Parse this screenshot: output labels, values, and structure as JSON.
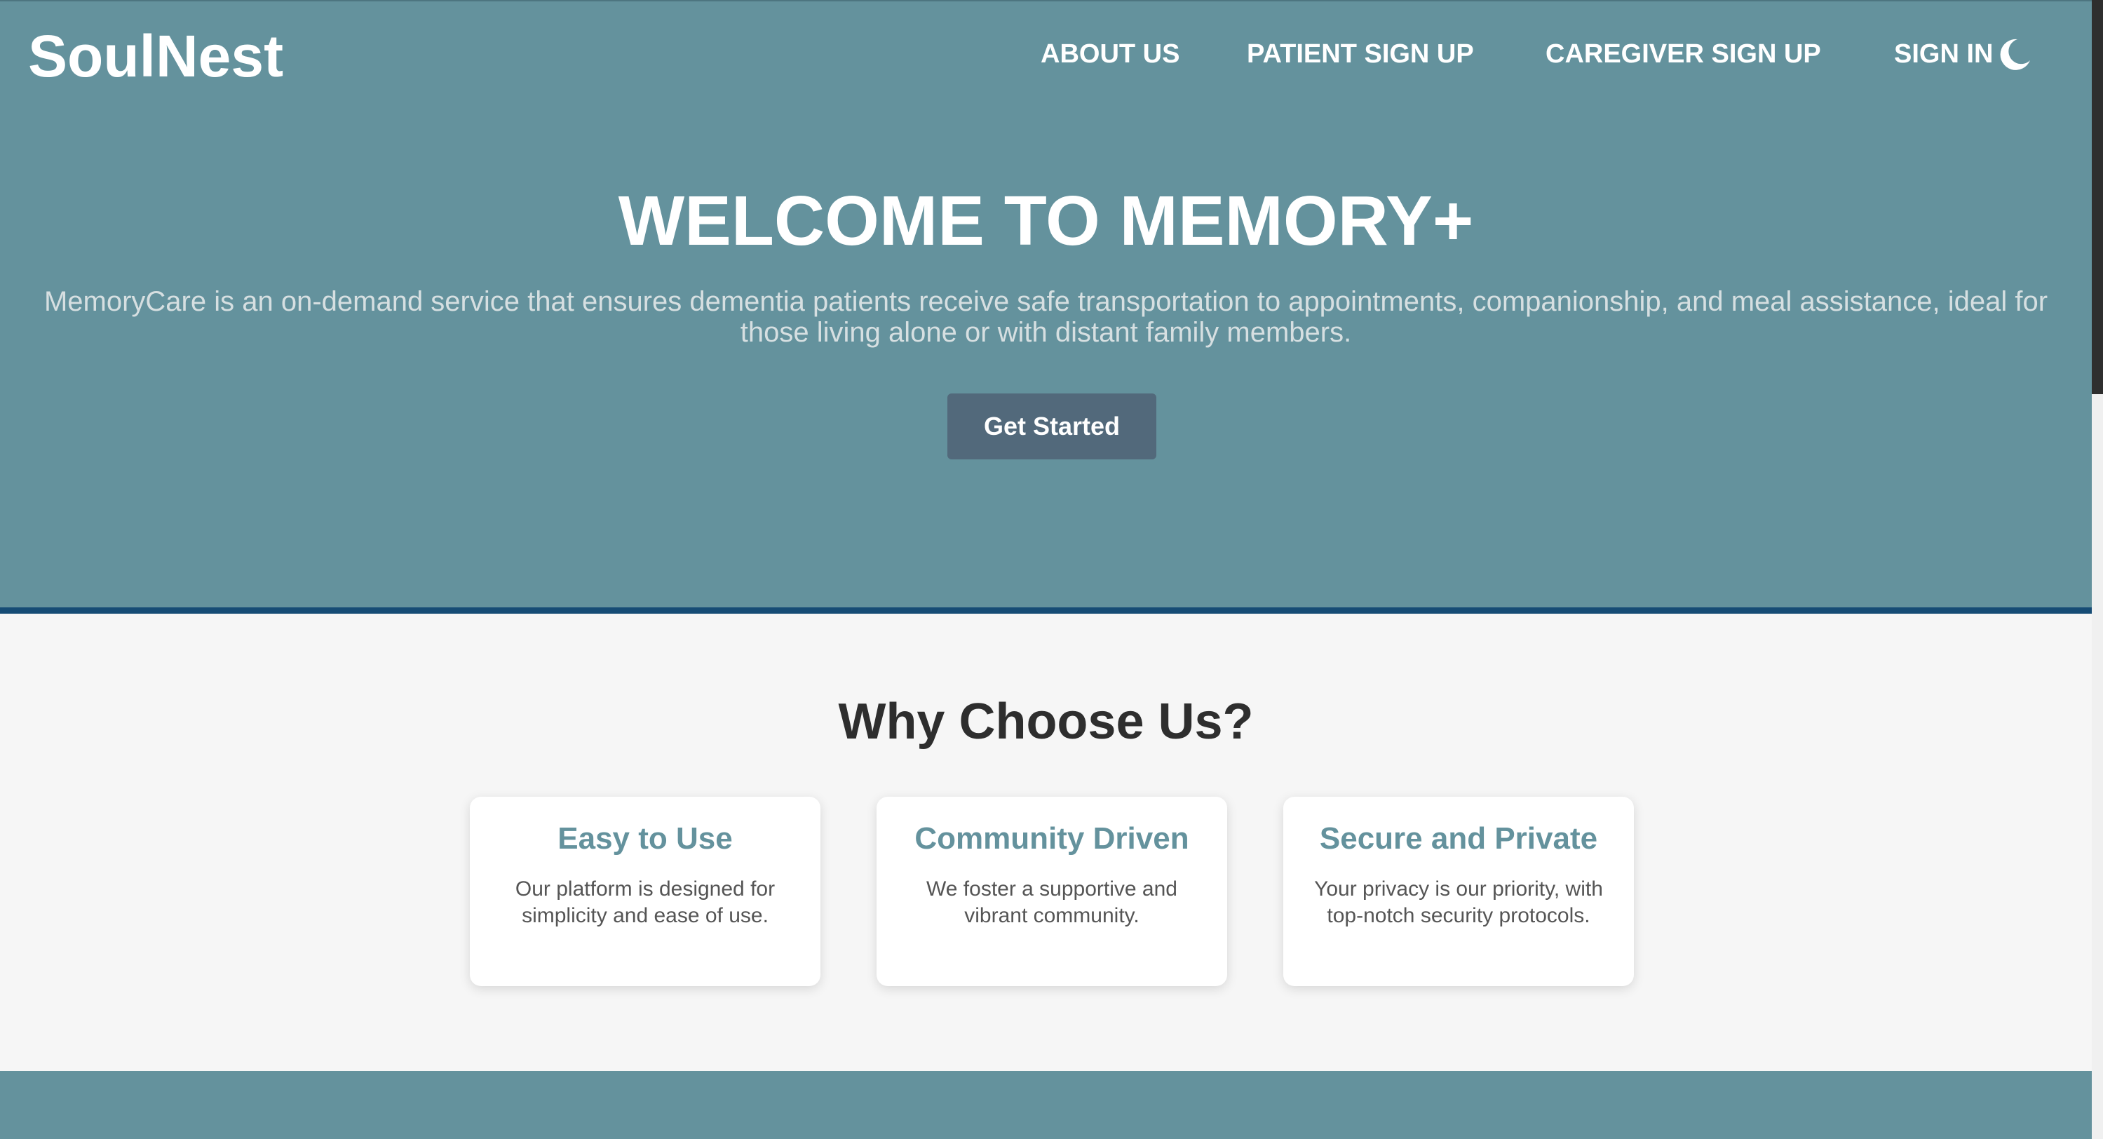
{
  "header": {
    "logo": "SoulNest",
    "nav": [
      "ABOUT US",
      "PATIENT SIGN UP",
      "CAREGIVER SIGN UP",
      "SIGN IN"
    ],
    "theme_toggle_icon": "moon-icon"
  },
  "hero": {
    "title": "WELCOME TO MEMORY+",
    "description": "MemoryCare is an on-demand service that ensures dementia patients receive safe transportation to appointments, companionship, and meal assistance, ideal for those living alone or with distant family members.",
    "cta_label": "Get Started"
  },
  "features": {
    "title": "Why Choose Us?",
    "cards": [
      {
        "title": "Easy to Use",
        "text": "Our platform is designed for simplicity and ease of use."
      },
      {
        "title": "Community Driven",
        "text": "We foster a supportive and vibrant community."
      },
      {
        "title": "Secure and Private",
        "text": "Your privacy is our priority, with top-notch security protocols."
      }
    ]
  },
  "colors": {
    "hero_bg": "#64929d",
    "hero_border": "#164c75",
    "button_bg": "#52697b",
    "card_title": "#64929d",
    "page_bg": "#f6f6f6"
  }
}
